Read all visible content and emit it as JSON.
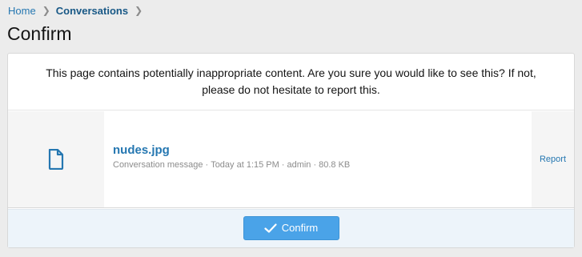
{
  "breadcrumb": {
    "items": [
      {
        "label": "Home"
      },
      {
        "label": "Conversations"
      }
    ]
  },
  "page": {
    "title": "Confirm"
  },
  "notice": {
    "line1": "This page contains potentially inappropriate content. Are you sure you would like to see this? If not,",
    "line2": "please do not hesitate to report this."
  },
  "attachment": {
    "icon": "file-icon",
    "filename": "nudes.jpg",
    "source": "Conversation message",
    "date": "Today at 1:15 PM",
    "user": "admin",
    "size": "80.8 KB",
    "report_label": "Report"
  },
  "actions": {
    "confirm_label": "Confirm",
    "confirm_icon": "check-icon"
  },
  "colors": {
    "link": "#2577b1",
    "button": "#4aa3e8",
    "footer": "#edf4fa"
  }
}
